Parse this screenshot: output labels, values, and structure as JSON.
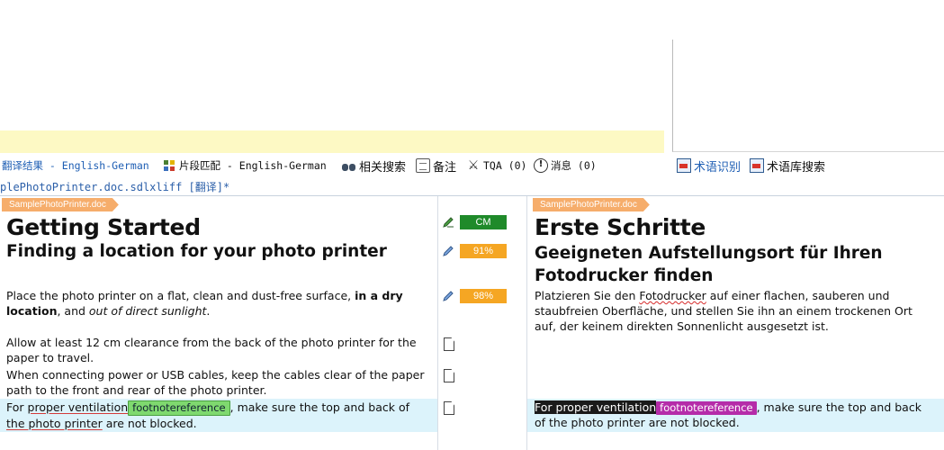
{
  "tabs": {
    "results_label": "翻译结果 - English-German",
    "fragment_label": "片段匹配 - English-German",
    "concordance_label": "相关搜索",
    "comments_label": "备注",
    "tqa_label": "TQA (0)",
    "messages_label": "消息 (0)",
    "term_recognition_label": "术语识别",
    "termbase_search_label": "术语库搜索"
  },
  "file_tab": {
    "label": "plePhotoPrinter.doc.sdlxliff [翻译]*"
  },
  "document_chip": "SamplePhotoPrinter.doc",
  "source": {
    "heading1": "Getting Started",
    "heading2": "Finding a location for your photo printer",
    "para1_a": "Place the photo printer on a flat, clean and dust-free surface, ",
    "para1_b": "in a dry location",
    "para1_c": ", and ",
    "para1_d": "out of direct sunlight",
    "para1_e": ".",
    "para2": "Allow at least 12 cm clearance from the back of the photo printer for the paper to travel.",
    "para3": "When connecting power or USB cables, keep the cables clear of the paper path to the front and rear of the photo printer.",
    "para4_a": "For ",
    "para4_b": "proper ventilation",
    "para4_tag": "footnotereference",
    "para4_c": ", make sure the top and back of ",
    "para4_d": "the photo printer",
    "para4_e": " are not blocked."
  },
  "target": {
    "heading1": "Erste Schritte",
    "heading2": "Geeigneten Aufstellungsort für Ihren Fotodrucker finden",
    "para1_a": "Platzieren Sie den ",
    "para1_b": "Fotodrucker",
    "para1_c": " auf einer flachen, sauberen und staubfreien Oberfläche, und stellen Sie ihn an einem trockenen Ort auf, der keinem direkten Sonnenlicht ausgesetzt ist.",
    "para4_sel": "For proper ventilation",
    "para4_tag": "footnotereference",
    "para4_c": ", make sure the top and back of the photo printer are not blocked."
  },
  "statuses": {
    "row1": "CM",
    "row2": "91%",
    "row3": "98%"
  },
  "colors": {
    "cm_green": "#1f8a2a",
    "fuzzy_orange": "#f5a623",
    "active_row": "#dcf3fb",
    "tag_magenta": "#b52ca9",
    "tag_green": "#7fd96f"
  }
}
